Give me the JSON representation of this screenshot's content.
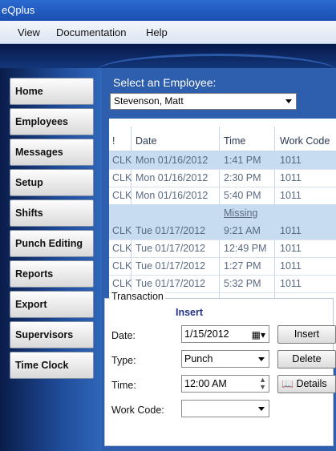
{
  "window": {
    "title": "eQplus"
  },
  "menu": {
    "items": [
      "View",
      "Documentation",
      "Help"
    ]
  },
  "nav": {
    "items": [
      "Home",
      "Employees",
      "Messages",
      "Setup",
      "Shifts",
      "Punch Editing",
      "Reports",
      "Export",
      "Supervisors",
      "Time Clock"
    ]
  },
  "employee": {
    "label": "Select an Employee:",
    "selected": "Stevenson, Matt"
  },
  "grid": {
    "headers": [
      "!",
      "Date",
      "Time",
      "Work Code"
    ],
    "rows": [
      {
        "type": "CLK",
        "date": "Mon 01/16/2012",
        "time": "1:41 PM",
        "code": "1011",
        "hl": true
      },
      {
        "type": "CLK",
        "date": "Mon 01/16/2012",
        "time": "2:30 PM",
        "code": "1011",
        "hl": false
      },
      {
        "type": "CLK",
        "date": "Mon 01/16/2012",
        "time": "5:40 PM",
        "code": "1011",
        "hl": false
      },
      {
        "type": "",
        "date": "",
        "time": "Missing",
        "code": "",
        "hl": true,
        "missing": true
      },
      {
        "type": "CLK",
        "date": "Tue 01/17/2012",
        "time": "9:21 AM",
        "code": "1011",
        "hl": true
      },
      {
        "type": "CLK",
        "date": "Tue 01/17/2012",
        "time": "12:49 PM",
        "code": "1011",
        "hl": false
      },
      {
        "type": "CLK",
        "date": "Tue 01/17/2012",
        "time": "1:27 PM",
        "code": "1011",
        "hl": false
      },
      {
        "type": "CLK",
        "date": "Tue 01/17/2012",
        "time": "5:32 PM",
        "code": "1011",
        "hl": false
      }
    ]
  },
  "transaction": {
    "legend": "Transaction",
    "mode": "Insert",
    "date_label": "Date:",
    "date_value": "1/15/2012",
    "type_label": "Type:",
    "type_value": "Punch",
    "time_label": "Time:",
    "time_value": "12:00 AM",
    "workcode_label": "Work Code:",
    "workcode_value": "",
    "buttons": {
      "insert": "Insert",
      "delete": "Delete",
      "details": "Details"
    }
  }
}
